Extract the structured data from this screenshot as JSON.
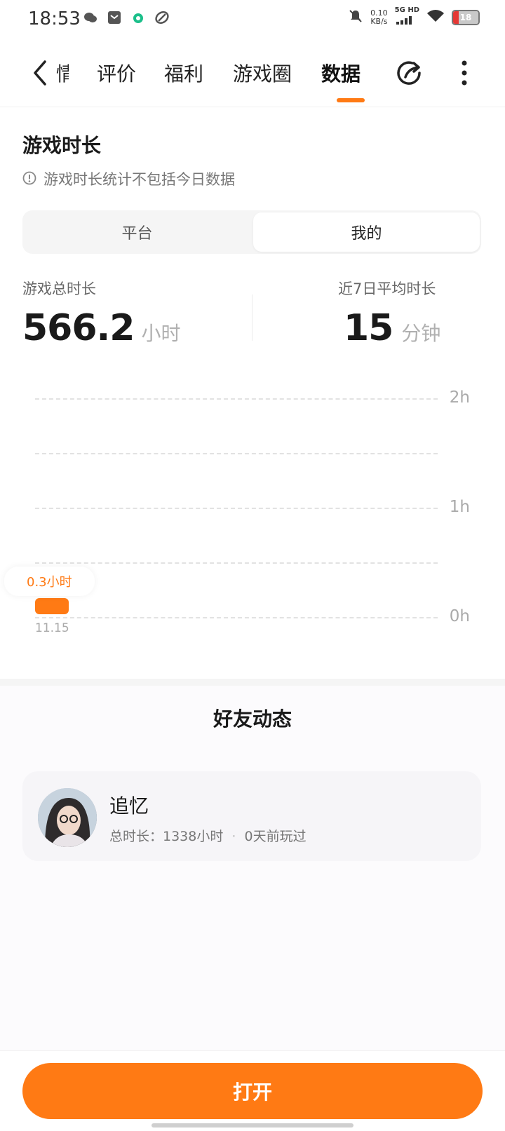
{
  "status_bar": {
    "time": "18:53",
    "notification_icons": [
      "wechat-icon",
      "mail-icon",
      "app-icon",
      "link-icon"
    ],
    "net_speed": "0.10",
    "net_speed_unit": "KB/s",
    "network": "5G HD",
    "battery_level": "18"
  },
  "nav": {
    "back_icon": "chevron-left-icon",
    "tabs": [
      {
        "label": "情",
        "active": false
      },
      {
        "label": "评价",
        "active": false
      },
      {
        "label": "福利",
        "active": false
      },
      {
        "label": "游戏圈",
        "active": false
      },
      {
        "label": "数据",
        "active": true
      }
    ],
    "share_icon": "share-icon",
    "more_icon": "more-vertical-icon",
    "accent_color": "#ff7a14"
  },
  "playtime": {
    "title": "游戏时长",
    "note": "游戏时长统计不包括今日数据",
    "segments": [
      {
        "label": "平台",
        "selected": false
      },
      {
        "label": "我的",
        "selected": true
      }
    ],
    "total_label": "游戏总时长",
    "total_value": "566.2",
    "total_unit": "小时",
    "avg_label": "近7日平均时长",
    "avg_value": "15",
    "avg_unit": "分钟"
  },
  "chart_data": {
    "type": "bar",
    "categories": [
      "11.15"
    ],
    "values": [
      0.3
    ],
    "ylim": [
      0,
      2
    ],
    "y_ticks": [
      "2h",
      "1h",
      "0h"
    ],
    "tooltip": "0.3小时",
    "grid": true
  },
  "friends": {
    "title": "好友动态",
    "items": [
      {
        "name": "追忆",
        "total_label": "总时长：1338小时",
        "last_played": "0天前玩过"
      }
    ]
  },
  "footer": {
    "open_label": "打开"
  }
}
